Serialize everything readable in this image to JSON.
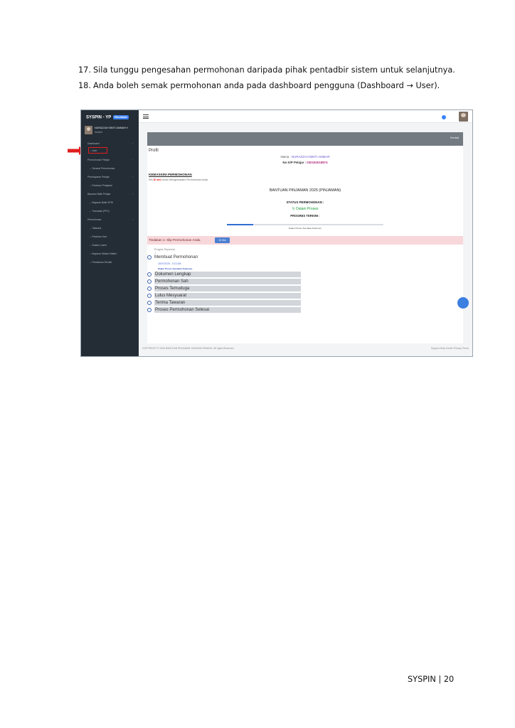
{
  "instructions": [
    {
      "num": "17.",
      "text": "Sila tunggu pengesahan permohonan daripada pihak pentadbir sistem untuk selanjutnya."
    },
    {
      "num": "18.",
      "text": "Anda boleh semak permohonan anda pada dashboard pengguna (Dashboard → User)."
    }
  ],
  "screenshot": {
    "sidebar": {
      "brand": "SYSPIN - YP",
      "brand_badge": "PINJAMAN",
      "user_name": "NURAZZAH BINTI AMMAR ▾",
      "user_role": "Student",
      "items": [
        "Dashboard",
        "→ User",
        "Permohonan Pelajar",
        "→ Senarai Permohonan",
        "Pembayaran Pelajar",
        "→ Panduan Pelajaran",
        "Bayaran Balik Pelajar",
        "→ Bayaran Balik SPHI",
        "→ Transaksi (FPX)",
        "Permohonan",
        "→ Tatacara",
        "→ Panduan Kad",
        "→ Soalan Lazim",
        "→ Bayaran Melalui Wallet",
        "→ Perbankan Sendiri"
      ]
    },
    "header_button": "Kembali",
    "profile_title": "Profil",
    "name_label": "Nama :",
    "name_value": "NURAZZAH BINTI AMMAR",
    "ic_label": "No K/P Pelajar :",
    "ic_value": "030192018874",
    "update_title": "KEMASKINI PERMOHONAN",
    "click_prefix": "Klik",
    "click_link": "Di sini",
    "click_suffix": "Untuk Mengemaskini Permohonan Anda",
    "program_title": "BANTUAN PINJAMAN 2025 (PINJAMAN)",
    "status_label": "STATUS PERMOHONAN :",
    "status_value": "↻ Dalam Proses",
    "progress_label": "PROGRES TERKINI :",
    "progress_fraction": 0.17,
    "progress_caption": "Dalam Proses Semakan Dokumen",
    "alert_text": "Tindakan 1: Slip Permohonan Anda.",
    "alert_button": "Di Sini",
    "timeline_label": "Progres Terperinci",
    "timeline_check": "✓",
    "steps": [
      {
        "label": "Membuat Permohonan"
      },
      {
        "label": "Dokumen Lengkap"
      },
      {
        "label": "Permohonan Sah"
      },
      {
        "label": "Proses Temuduga"
      },
      {
        "label": "Lulus Mesyuarat"
      },
      {
        "label": "Terima Tawaran"
      },
      {
        "label": "Proses Permohonan Selesai"
      }
    ],
    "step_date": "15/07/2025 - 9:22 AM",
    "step_status": "Dalam Proses Semakan Dokumen",
    "footer_left": "COPYRIGHT © 2025 BANTUAN PINJAMAN YAYASAN PAHANG. All rights Reserved",
    "footer_right": "Support  Help Center  Privacy  Terms"
  },
  "colors": {
    "arrow": "#e0201f",
    "sidebar": "#242d36",
    "accent": "#3b82f6"
  },
  "page_footer": "SYSPIN | 20"
}
